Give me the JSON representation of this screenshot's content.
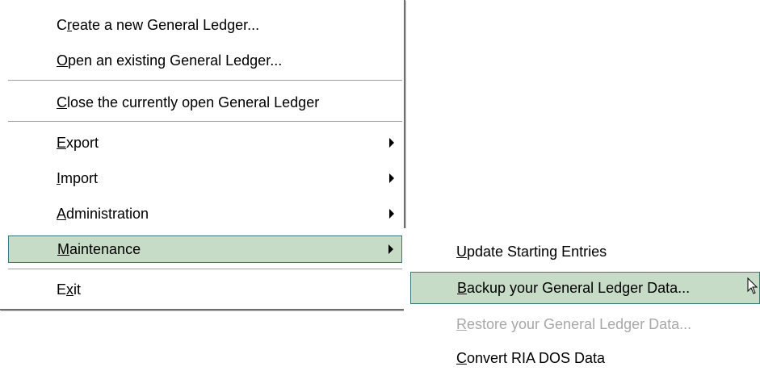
{
  "main_menu": {
    "items": [
      {
        "pre": "C",
        "acc": "r",
        "post": "eate a new General Ledger..."
      },
      {
        "pre": "",
        "acc": "O",
        "post": "pen an existing General Ledger..."
      },
      {
        "pre": "",
        "acc": "C",
        "post": "lose the currently open General Ledger"
      },
      {
        "pre": "",
        "acc": "E",
        "post": "xport"
      },
      {
        "pre": "",
        "acc": "I",
        "post": "mport"
      },
      {
        "pre": "",
        "acc": "A",
        "post": "dministration"
      },
      {
        "pre": "",
        "acc": "M",
        "post": "aintenance"
      },
      {
        "pre": "E",
        "acc": "x",
        "post": "it"
      }
    ]
  },
  "sub_menu": {
    "items": [
      {
        "pre": "",
        "acc": "U",
        "post": "pdate Starting Entries"
      },
      {
        "pre": "",
        "acc": "B",
        "post": "ackup your General Ledger Data..."
      },
      {
        "pre": "",
        "acc": "R",
        "post": "estore your General Ledger Data..."
      },
      {
        "pre": "",
        "acc": "C",
        "post": "onvert RIA DOS Data"
      }
    ]
  },
  "colors": {
    "highlight": "#c6dcc6",
    "highlight_border": "#3a7a7a",
    "disabled_text": "#a8a8a8"
  }
}
